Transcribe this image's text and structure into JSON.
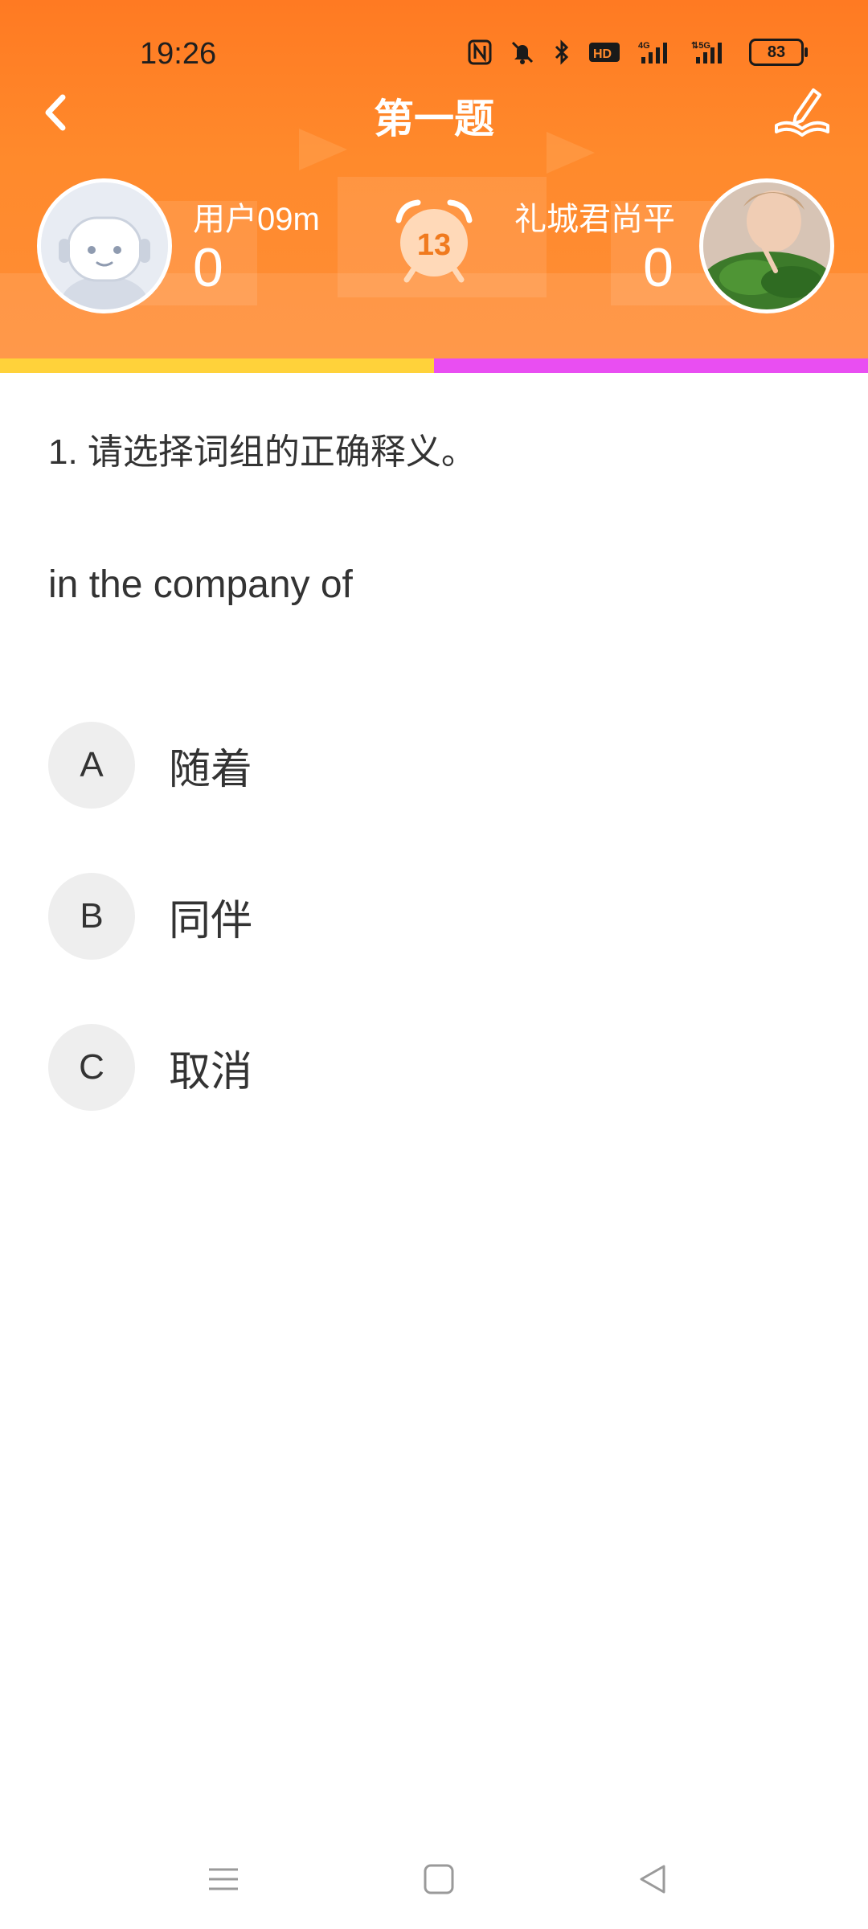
{
  "status_bar": {
    "time": "19:26",
    "battery": "83",
    "icons": [
      "nfc-icon",
      "mute-icon",
      "bluetooth-icon",
      "hd-icon",
      "signal-4g-icon",
      "signal-5g-icon",
      "battery-icon"
    ]
  },
  "header": {
    "title": "第一题",
    "back_icon": "back-chevron-icon",
    "edit_icon": "pencil-book-icon",
    "accent_color": "#ff8a2c"
  },
  "players": {
    "left": {
      "name": "用户09m",
      "score": "0",
      "avatar": "robot-avatar"
    },
    "right": {
      "name": "礼城君尚平",
      "score": "0",
      "avatar": "photo-avatar"
    }
  },
  "timer": {
    "value": "13",
    "icon": "alarm-clock-icon"
  },
  "progress": {
    "left_fraction": 0.5,
    "left_color": "#ffd23a",
    "right_color": "#e94ef2"
  },
  "question": {
    "prompt": "1.  请选择词组的正确释义。",
    "phrase": "in the company of"
  },
  "options": [
    {
      "letter": "A",
      "text": "随着"
    },
    {
      "letter": "B",
      "text": "同伴"
    },
    {
      "letter": "C",
      "text": "取消"
    }
  ],
  "nav_bar": {
    "icons": [
      "menu-icon",
      "home-icon",
      "back-icon"
    ]
  }
}
